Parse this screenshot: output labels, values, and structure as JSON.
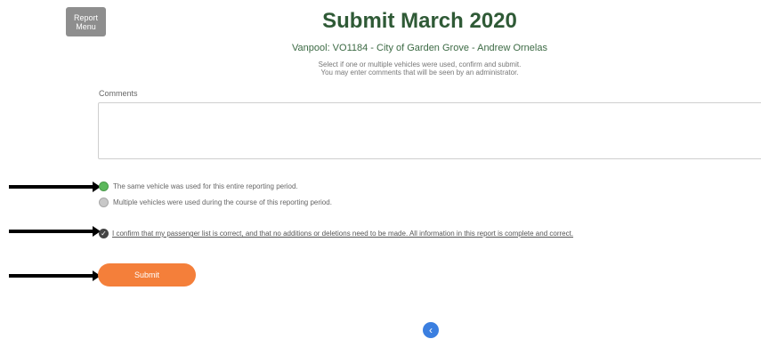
{
  "header": {
    "report_menu_line1": "Report",
    "report_menu_line2": "Menu",
    "title": "Submit March 2020",
    "subtitle": "Vanpool: VO1184 - City of Garden Grove - Andrew Ornelas",
    "instruction_line1": "Select if one or multiple vehicles were used, confirm and submit.",
    "instruction_line2": "You may enter comments that will be seen by an administrator."
  },
  "comments": {
    "label": "Comments",
    "value": ""
  },
  "vehicle_options": [
    {
      "label": "The same vehicle was used for this entire reporting period.",
      "selected": true
    },
    {
      "label": "Multiple vehicles were used during the course of this reporting period.",
      "selected": false
    }
  ],
  "confirm": {
    "label": "I confirm that my passenger list is correct, and that no additions or deletions need to be made. All information in this report is complete and correct.",
    "checked": true
  },
  "submit_label": "Submit",
  "icons": {
    "back": "chevron-left-icon",
    "check": "check-icon"
  },
  "colors": {
    "title": "#2f5a36",
    "submit": "#f47f3a",
    "radio_selected": "#5cb85c",
    "back_button": "#3b7fe0"
  }
}
